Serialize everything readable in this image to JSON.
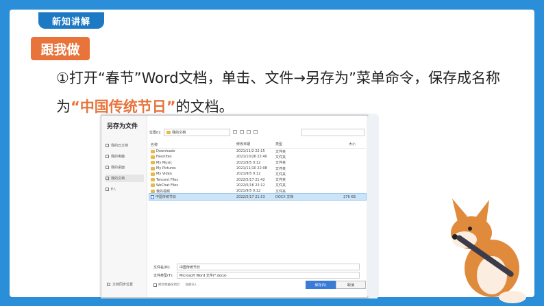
{
  "slide": {
    "section_tag": "新知讲解",
    "label_badge": "跟我做",
    "instruction_pre": "①打开“春节”Word文档，单击、文件→另存为”菜单命令，保存成名称为",
    "instruction_highlight": "“中国传统节日”",
    "instruction_post": "的文档。"
  },
  "dialog": {
    "title": "另存为文件",
    "sidebar": [
      {
        "label": "我的云文档",
        "selected": false
      },
      {
        "label": "我的电脑",
        "selected": false
      },
      {
        "label": "我的桌面",
        "selected": false
      },
      {
        "label": "我的文档",
        "selected": true
      },
      {
        "label": "E:\\",
        "selected": false
      }
    ],
    "sidebar_bottom": "文档同步位置",
    "location_label": "位置(I):",
    "location_value": "我的文档",
    "columns": [
      "名称",
      "修改日期",
      "类型",
      "大小"
    ],
    "files": [
      {
        "name": "Downloads",
        "date": "2021/11/2 22:15",
        "type": "文件夹",
        "size": "",
        "icon": "folder"
      },
      {
        "name": "Favorites",
        "date": "2021/10/26 22:40",
        "type": "文件夹",
        "size": "",
        "icon": "folder"
      },
      {
        "name": "My Music",
        "date": "2021/9/5 0:12",
        "type": "文件夹",
        "size": "",
        "icon": "folder"
      },
      {
        "name": "My Pictures",
        "date": "2021/11/10 22:08",
        "type": "文件夹",
        "size": "",
        "icon": "folder"
      },
      {
        "name": "My Video",
        "date": "2021/9/5 0:12",
        "type": "文件夹",
        "size": "",
        "icon": "folder"
      },
      {
        "name": "Tencent Files",
        "date": "2022/5/17 21:42",
        "type": "文件夹",
        "size": "",
        "icon": "folder"
      },
      {
        "name": "WeChat Files",
        "date": "2022/5/16 22:12",
        "type": "文件夹",
        "size": "",
        "icon": "folder"
      },
      {
        "name": "我的视频",
        "date": "2021/9/5 0:12",
        "type": "文件夹",
        "size": "",
        "icon": "folder"
      },
      {
        "name": "中国传统节日",
        "date": "2022/5/17 21:53",
        "type": "DOCX 文档",
        "size": "276 KB",
        "icon": "doc"
      }
    ],
    "selected_index": 8,
    "filename_label": "文件名(N):",
    "filename_value": "中国传统节日",
    "filetype_label": "文件类型(T):",
    "filetype_value": "Microsoft Word 文件(*.docx)",
    "checkbox_label": "把文档备份到云",
    "encrypt_label": "加密(E)...",
    "save_button": "保存(S)",
    "cancel_button": "取消"
  },
  "colors": {
    "frame": "#2b8ed8",
    "accent": "#e8743b",
    "tag": "#1e79c4",
    "selection": "#cce4f7"
  }
}
